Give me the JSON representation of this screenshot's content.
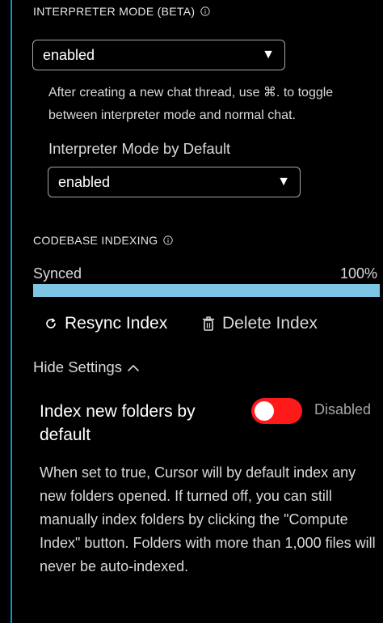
{
  "interpreter": {
    "section_title": "INTERPRETER MODE (BETA)",
    "select_value": "enabled",
    "help_text": "After creating a new chat thread, use ⌘. to toggle between interpreter mode and normal chat.",
    "default_label": "Interpreter Mode by Default",
    "default_select_value": "enabled"
  },
  "indexing": {
    "section_title": "CODEBASE INDEXING",
    "status_label": "Synced",
    "progress_text": "100%",
    "progress_fraction": 1.0,
    "resync_label": "Resync Index",
    "delete_label": "Delete Index",
    "hide_settings_label": "Hide Settings"
  },
  "setting": {
    "title": "Index new folders by default",
    "toggle_state": "Disabled",
    "description": "When set to true, Cursor will by default index any new folders opened. If turned off, you can still manually index folders by clicking the \"Compute Index\" button. Folders with more than 1,000 files will never be auto-indexed."
  },
  "colors": {
    "accent_border": "#1e8bc3",
    "progress_fill": "#7ec6e6",
    "toggle_off": "#ff1a1a"
  },
  "icons": {
    "info": "info-icon",
    "caret": "caret-down-icon",
    "resync": "refresh-icon",
    "delete": "trash-icon",
    "hide": "chevron-up-icon"
  }
}
